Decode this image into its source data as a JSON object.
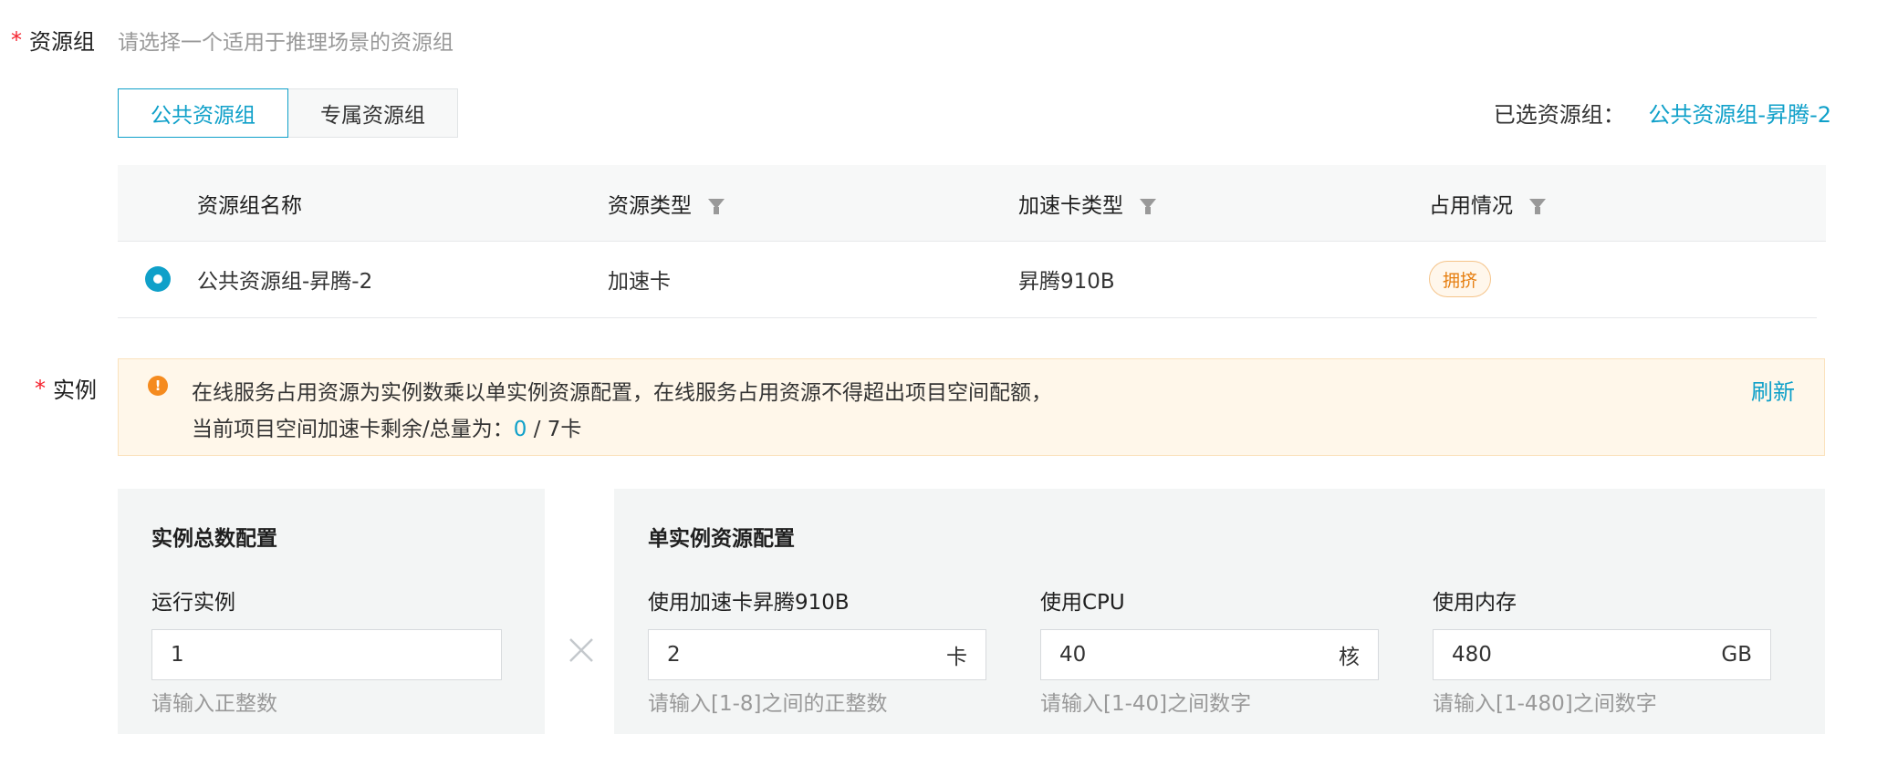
{
  "resource_group": {
    "label": "资源组",
    "hint": "请选择一个适用于推理场景的资源组",
    "tabs": [
      {
        "label": "公共资源组",
        "active": true
      },
      {
        "label": "专属资源组",
        "active": false
      }
    ],
    "selected_label": "已选资源组：",
    "selected_value": "公共资源组-昇腾-2",
    "table": {
      "headers": [
        "资源组名称",
        "资源类型",
        "加速卡类型",
        "占用情况"
      ],
      "rows": [
        {
          "name": "公共资源组-昇腾-2",
          "type": "加速卡",
          "card": "昇腾910B",
          "status": "拥挤",
          "selected": true
        }
      ]
    }
  },
  "instance": {
    "label": "实例",
    "alert": {
      "line1": "在线服务占用资源为实例数乘以单实例资源配置，在线服务占用资源不得超出项目空间配额，",
      "line2_prefix": "当前项目空间加速卡剩余/总量为：",
      "remaining": "0",
      "total": " / 7卡",
      "refresh": "刷新"
    },
    "total_config": {
      "title": "实例总数配置",
      "running_label": "运行实例",
      "running_value": "1",
      "running_hint": "请输入正整数"
    },
    "single_config": {
      "title": "单实例资源配置",
      "card": {
        "label": "使用加速卡昇腾910B",
        "value": "2",
        "unit": "卡",
        "hint": "请输入[1-8]之间的正整数"
      },
      "cpu": {
        "label": "使用CPU",
        "value": "40",
        "unit": "核",
        "hint": "请输入[1-40]之间数字"
      },
      "memory": {
        "label": "使用内存",
        "value": "480",
        "unit": "GB",
        "hint": "请输入[1-480]之间数字"
      }
    }
  },
  "colors": {
    "accent": "#0fa0c9",
    "required": "#f5222d",
    "warning": "#f58b1f",
    "tag_busy": "#e67f11"
  }
}
